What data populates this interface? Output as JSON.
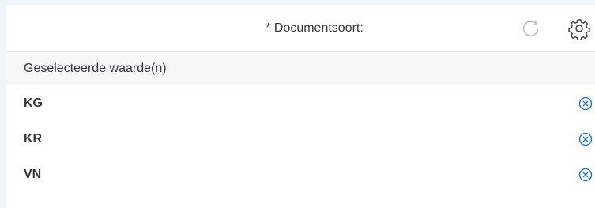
{
  "header": {
    "title": "* Documentsoort:",
    "icons": {
      "refresh": "refresh-icon",
      "settings": "gear-icon"
    }
  },
  "section": {
    "label": "Geselecteerde waarde(n)"
  },
  "values": [
    {
      "label": "KG",
      "remove_icon": "remove-icon"
    },
    {
      "label": "KR",
      "remove_icon": "remove-icon"
    },
    {
      "label": "VN",
      "remove_icon": "remove-icon"
    }
  ],
  "colors": {
    "accent": "#0a6ed1",
    "muted_icon": "#b8c0c8",
    "text": "#32363a",
    "background": "#eef5fc"
  }
}
